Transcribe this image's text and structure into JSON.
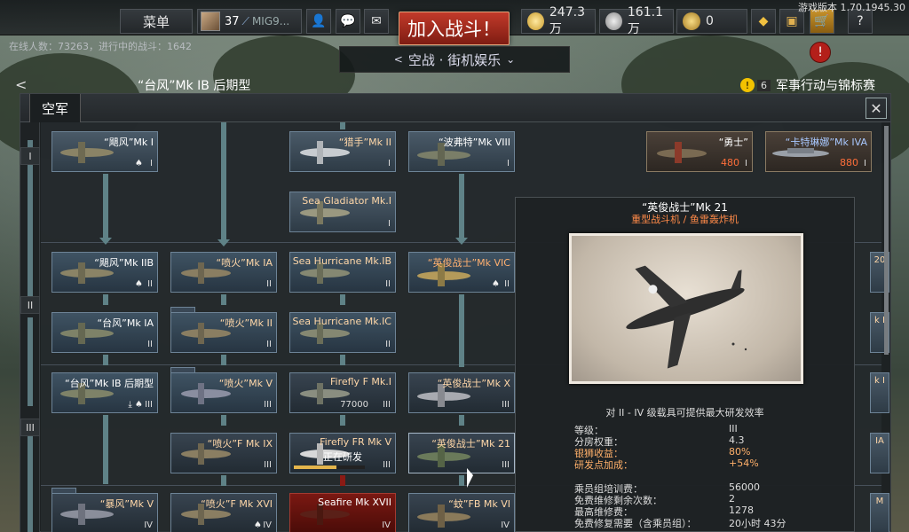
{
  "version": "游戏版本 1.70.1945.30",
  "topbar": {
    "menu_label": "菜单",
    "rank": "37",
    "player_name": "MIG9...",
    "join_battle_label": "加入战斗！",
    "research_points": "247.3万",
    "silver_lions": "161.1万",
    "golden_eagles": "0",
    "help_label": "?"
  },
  "online": {
    "text": "在线人数：73263，进行中的战斗：1642"
  },
  "game_mode": {
    "label": "空战 · 街机娱乐"
  },
  "vehicle_title": "“台风”Mk IB 后期型",
  "events": {
    "badge": "!",
    "count": "6",
    "label": "军事行动与锦标赛"
  },
  "window": {
    "tab_label": "空军",
    "close_label": "✕",
    "ranks": [
      "I",
      "II",
      "III"
    ]
  },
  "cards": [
    {
      "name": "“飓风”Mk I",
      "rank": "I",
      "icons": "♠"
    },
    {
      "name": "“猎手”Mk II",
      "rank": "I"
    },
    {
      "name": "“波弗特”Mk VIII",
      "rank": "I",
      "white": true
    },
    {
      "name": "“勇士”",
      "rank": "I",
      "white": true,
      "ge": "480"
    },
    {
      "name": "“卡特琳娜”Mk IVA",
      "rank": "I",
      "ge": "880"
    },
    {
      "name": "Sea Gladiator Mk.I",
      "rank": "I"
    },
    {
      "name": "“飓风”Mk IIB",
      "rank": "II",
      "icons": "♠"
    },
    {
      "name": "“喷火”Mk IA",
      "rank": "II"
    },
    {
      "name": "Sea Hurricane Mk.IB",
      "rank": "II"
    },
    {
      "name": "“英俊战士”Mk VIC",
      "rank": "II",
      "icons": "♠"
    },
    {
      "name": "“台风”Mk IA",
      "rank": "II"
    },
    {
      "name": "“喷火”Mk II",
      "rank": "II"
    },
    {
      "name": "Sea Hurricane Mk.IC",
      "rank": "II"
    },
    {
      "name": "“台风”Mk IB 后期型",
      "rank": "III",
      "icons": "⤓ ♠",
      "white": true
    },
    {
      "name": "“喷火”Mk V",
      "rank": "III"
    },
    {
      "name": "Firefly F Mk.I",
      "rank": "III",
      "cost": "77000"
    },
    {
      "name": "“英俊战士”Mk X",
      "rank": "III"
    },
    {
      "name": "“喷火”F Mk IX",
      "rank": "III"
    },
    {
      "name": "Firefly FR Mk V",
      "rank": "III",
      "status": "正在研发"
    },
    {
      "name": "“英俊战士”Mk 21",
      "rank": "III"
    },
    {
      "name": "“暴风”Mk V",
      "rank": "IV"
    },
    {
      "name": "“喷火”F Mk XVI",
      "rank": "IV",
      "icons": "♠"
    },
    {
      "name": "Seafire Mk XVII",
      "rank": "IV",
      "white": true
    },
    {
      "name": "“蚊”FB Mk VI",
      "rank": "IV"
    }
  ],
  "right_clips": [
    "20",
    "k I",
    "k I",
    "IA",
    "M"
  ],
  "detail": {
    "title": "“英俊战士”Mk 21",
    "type": "重型战斗机 / 鱼雷轰炸机",
    "note": "对 II - IV 级载具可提供最大研发效率",
    "stats": [
      {
        "label": "等级：",
        "value": "III"
      },
      {
        "label": "分房权重：",
        "value": "4.3"
      },
      {
        "label": "银狮收益：",
        "value": "80%",
        "highlight": true
      },
      {
        "label": "研发点加成：",
        "value": "+54%",
        "highlight": true
      },
      {
        "label": "乘员组培训费：",
        "value": "56000"
      },
      {
        "label": "免费维修剩余次数：",
        "value": "2"
      },
      {
        "label": "最高维修费：",
        "value": "1278"
      },
      {
        "label": "免费修复需要（含乘员组）：",
        "value": "20小时 43分"
      }
    ]
  },
  "colors": {
    "join_button": "#b3311f",
    "research_line": "#5f8287",
    "locked_line": "#8b1a14",
    "name_text": "#ffd7a8",
    "highlight": "#ffb06a"
  }
}
